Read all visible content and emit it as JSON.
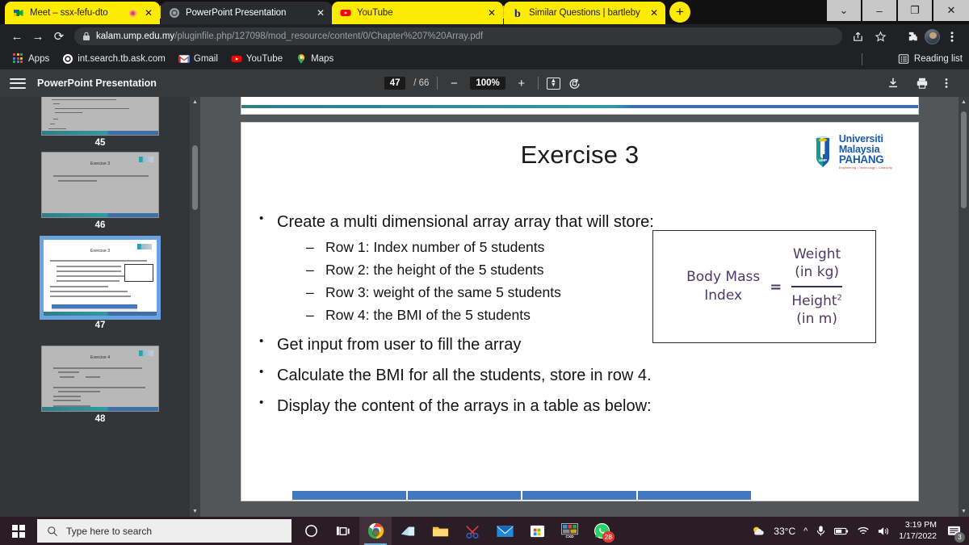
{
  "window": {
    "controls": [
      {
        "name": "dropdown",
        "glyph": "⌄"
      },
      {
        "name": "minimize",
        "glyph": "–"
      },
      {
        "name": "restore",
        "glyph": "❐"
      },
      {
        "name": "close",
        "glyph": "✕"
      }
    ]
  },
  "tabs": [
    {
      "title": "Meet – ssx-fefu-dto",
      "icon": "google-meet-icon",
      "active": false,
      "recording": true,
      "close": "✕"
    },
    {
      "title": "PowerPoint Presentation",
      "icon": "pdf-globe-icon",
      "active": true,
      "recording": false,
      "close": "✕"
    },
    {
      "title": "YouTube",
      "icon": "youtube-icon",
      "active": false,
      "recording": false,
      "close": "✕"
    },
    {
      "title": "Similar Questions | bartleby",
      "icon": "bartleby-icon",
      "active": false,
      "recording": false,
      "close": "✕"
    }
  ],
  "newtab_label": "+",
  "toolbar": {
    "back": "←",
    "forward": "→",
    "reload": "⟳",
    "url_domain": "kalam.ump.edu.my",
    "url_path": "/pluginfile.php/127098/mod_resource/content/0/Chapter%207%20Array.pdf",
    "lock_icon": "lock-icon",
    "share_icon": "share-icon",
    "star_icon": "star-icon",
    "extensions_icon": "puzzle-icon",
    "profile_icon": "profile-avatar",
    "menu_icon": "three-dot-menu-icon"
  },
  "bookmarks": {
    "items": [
      {
        "label": "Apps",
        "icon": "apps-grid-icon"
      },
      {
        "label": "int.search.tb.ask.com",
        "icon": "ask-globe-icon"
      },
      {
        "label": "Gmail",
        "icon": "gmail-icon"
      },
      {
        "label": "YouTube",
        "icon": "youtube-icon"
      },
      {
        "label": "Maps",
        "icon": "maps-pin-icon"
      }
    ],
    "reading_list": "Reading list"
  },
  "pdf": {
    "title": "PowerPoint Presentation",
    "menu_icon": "hamburger-menu-icon",
    "page_current": "47",
    "page_total": "/ 66",
    "zoom_out": "−",
    "zoom_level": "100%",
    "zoom_in": "+",
    "fit_page_icon": "fit-to-page-icon",
    "rotate_icon": "rotate-icon",
    "download_icon": "download-icon",
    "print_icon": "print-icon",
    "more_icon": "more-options-icon"
  },
  "thumbnails": [
    {
      "label": "45",
      "type": "code",
      "selected": false
    },
    {
      "label": "46",
      "type": "exercise3",
      "title": "Exercise 3",
      "body": "Modify exercise 2 so that it display the sum of the numbers",
      "selected": false
    },
    {
      "label": "47",
      "type": "current",
      "title": "Exercise 3",
      "selected": true
    },
    {
      "label": "48",
      "type": "exercise4",
      "title": "Exercise 4",
      "body": "Create two multidimensional array to store these matrices",
      "selected": false
    }
  ],
  "slide": {
    "title": "Exercise 3",
    "logo": {
      "line1": "Universiti",
      "line2": "Malaysia",
      "line3": "PAHANG",
      "tagline": "Engineering • Technology • Creativity",
      "mark_text": "UMP"
    },
    "bullets": [
      {
        "level": 1,
        "marker": "•",
        "text": "Create a multi dimensional array  array that will store:"
      },
      {
        "level": 2,
        "marker": "–",
        "text": "Row 1: Index number of 5 students"
      },
      {
        "level": 2,
        "marker": "–",
        "text": "Row 2: the height of the 5 students"
      },
      {
        "level": 2,
        "marker": "–",
        "text": "Row 3: weight of the same 5 students"
      },
      {
        "level": 2,
        "marker": "–",
        "text": "Row 4: the BMI of the 5 students"
      },
      {
        "level": 1,
        "marker": "•",
        "text": "Get input from user to fill the array"
      },
      {
        "level": 1,
        "marker": "•",
        "text": "Calculate the BMI for all the students, store in row 4."
      },
      {
        "level": 1,
        "marker": "•",
        "text": "Display the content of the arrays in a table as below:"
      }
    ],
    "bmi_formula": {
      "left_line1": "Body Mass",
      "left_line2": "Index",
      "equals": "=",
      "numerator_line1": "Weight",
      "numerator_line2": "(in kg)",
      "denominator_line1": "Height",
      "denominator_exp": "2",
      "denominator_line2": "(in m)"
    },
    "table_columns": 4
  },
  "taskbar": {
    "start_icon": "windows-start-icon",
    "search_placeholder": "Type here to search",
    "search_icon": "search-icon",
    "icons": [
      {
        "name": "cortana-circle-icon",
        "badge": null
      },
      {
        "name": "task-view-icon",
        "badge": null
      },
      {
        "name": "google-chrome-icon",
        "badge": null,
        "active": true
      },
      {
        "name": "office-icon",
        "badge": null
      },
      {
        "name": "file-explorer-icon",
        "badge": null
      },
      {
        "name": "snipping-tool-icon",
        "badge": null
      },
      {
        "name": "mail-icon",
        "badge": null
      },
      {
        "name": "microsoft-store-icon",
        "badge": null
      },
      {
        "name": "cxd-app-icon",
        "badge": null
      },
      {
        "name": "whatsapp-icon",
        "badge": "28"
      }
    ],
    "tray": {
      "weather_icon": "partly-cloudy-icon",
      "temperature": "33°C",
      "overflow_icon": "show-hidden-icons-chevron",
      "mic_icon": "microphone-icon",
      "battery_icon": "battery-icon",
      "wifi_icon": "wifi-icon",
      "volume_icon": "volume-icon",
      "time": "3:19 PM",
      "date": "1/17/2022",
      "notification_icon": "action-center-icon",
      "notification_count": "3"
    }
  },
  "colors": {
    "tab_yellow": "#ffeb00",
    "chrome_dark": "#202124",
    "pdf_bg": "#525659",
    "taskbar": "#2b1d26",
    "table_header_blue": "#4178be",
    "ump_blue": "#1b5aa8",
    "bmi_purple": "#4b3a66"
  }
}
